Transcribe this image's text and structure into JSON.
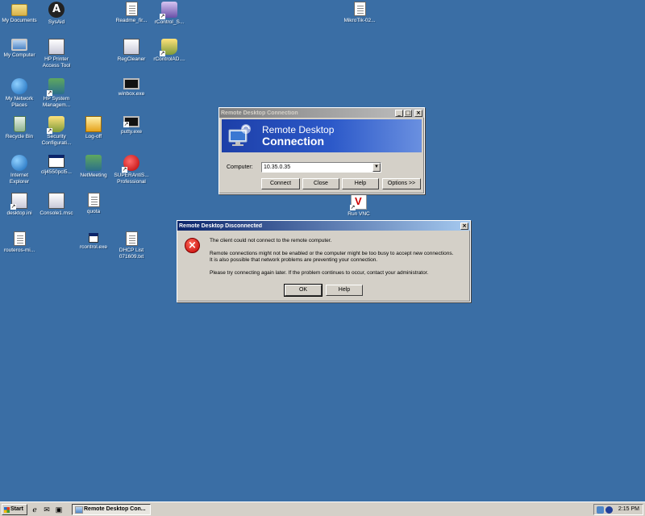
{
  "desktop": {
    "icons": [
      {
        "label": "My Documents",
        "icon": "folder-icon"
      },
      {
        "label": "SysAid",
        "icon": "sysaid-icon"
      },
      {
        "label": "Readme_fir...",
        "icon": "document-icon"
      },
      {
        "label": "rControl_S...",
        "icon": "rcontrol-icon"
      },
      {
        "label": "MikroTik-02...",
        "icon": "document-icon"
      },
      {
        "label": "My Computer",
        "icon": "computer-icon"
      },
      {
        "label": "HP Printer Access Tool",
        "icon": "app-icon"
      },
      {
        "label": "RegCleaner",
        "icon": "app-icon"
      },
      {
        "label": "rControlAD....",
        "icon": "rcontrol-icon"
      },
      {
        "label": "My Network Places",
        "icon": "network-places-icon"
      },
      {
        "label": "HP System Managem...",
        "icon": "hp-icon"
      },
      {
        "label": "winbox.exe",
        "icon": "winbox-icon"
      },
      {
        "label": "Recycle Bin",
        "icon": "recycle-bin-icon"
      },
      {
        "label": "Security Configurati...",
        "icon": "security-icon"
      },
      {
        "label": "Log-off",
        "icon": "key-icon"
      },
      {
        "label": "putty.exe",
        "icon": "putty-icon"
      },
      {
        "label": "Run VNC",
        "icon": "vnc-icon"
      },
      {
        "label": "Internet Explorer",
        "icon": "ie-icon"
      },
      {
        "label": "clj4550pcl5...",
        "icon": "window-icon"
      },
      {
        "label": "NetMeeting",
        "icon": "netmeeting-icon"
      },
      {
        "label": "SUPERAntiS... Professional",
        "icon": "superantispyware-icon"
      },
      {
        "label": "desktop.ini",
        "icon": "settings-file-icon"
      },
      {
        "label": "Console1.msc",
        "icon": "console-icon"
      },
      {
        "label": "quota",
        "icon": "document-icon"
      },
      {
        "label": "routeros-mi...",
        "icon": "document-icon"
      },
      {
        "label": "rcontrol.exe",
        "icon": "window-icon"
      },
      {
        "label": "DHCP List 071609.txt",
        "icon": "document-icon"
      }
    ]
  },
  "rdc_window": {
    "title": "Remote Desktop Connection",
    "banner_line1": "Remote Desktop",
    "banner_line2": "Connection",
    "computer_label": "Computer:",
    "computer_value": "10.35.0.35",
    "buttons": {
      "connect": "Connect",
      "close": "Close",
      "help": "Help",
      "options": "Options >>"
    }
  },
  "error_dialog": {
    "title": "Remote Desktop Disconnected",
    "line1": "The client could not connect to the remote computer.",
    "line2": "Remote connections might not be enabled or the computer might be too busy to accept new connections.",
    "line3": "It is also possible that network problems are preventing your connection.",
    "line4": "Please try connecting again later. If the problem continues to occur, contact your administrator.",
    "ok_label": "OK",
    "help_label": "Help"
  },
  "taskbar": {
    "start_label": "Start",
    "task_label": "Remote Desktop Con...",
    "clock": "2:15 PM"
  }
}
